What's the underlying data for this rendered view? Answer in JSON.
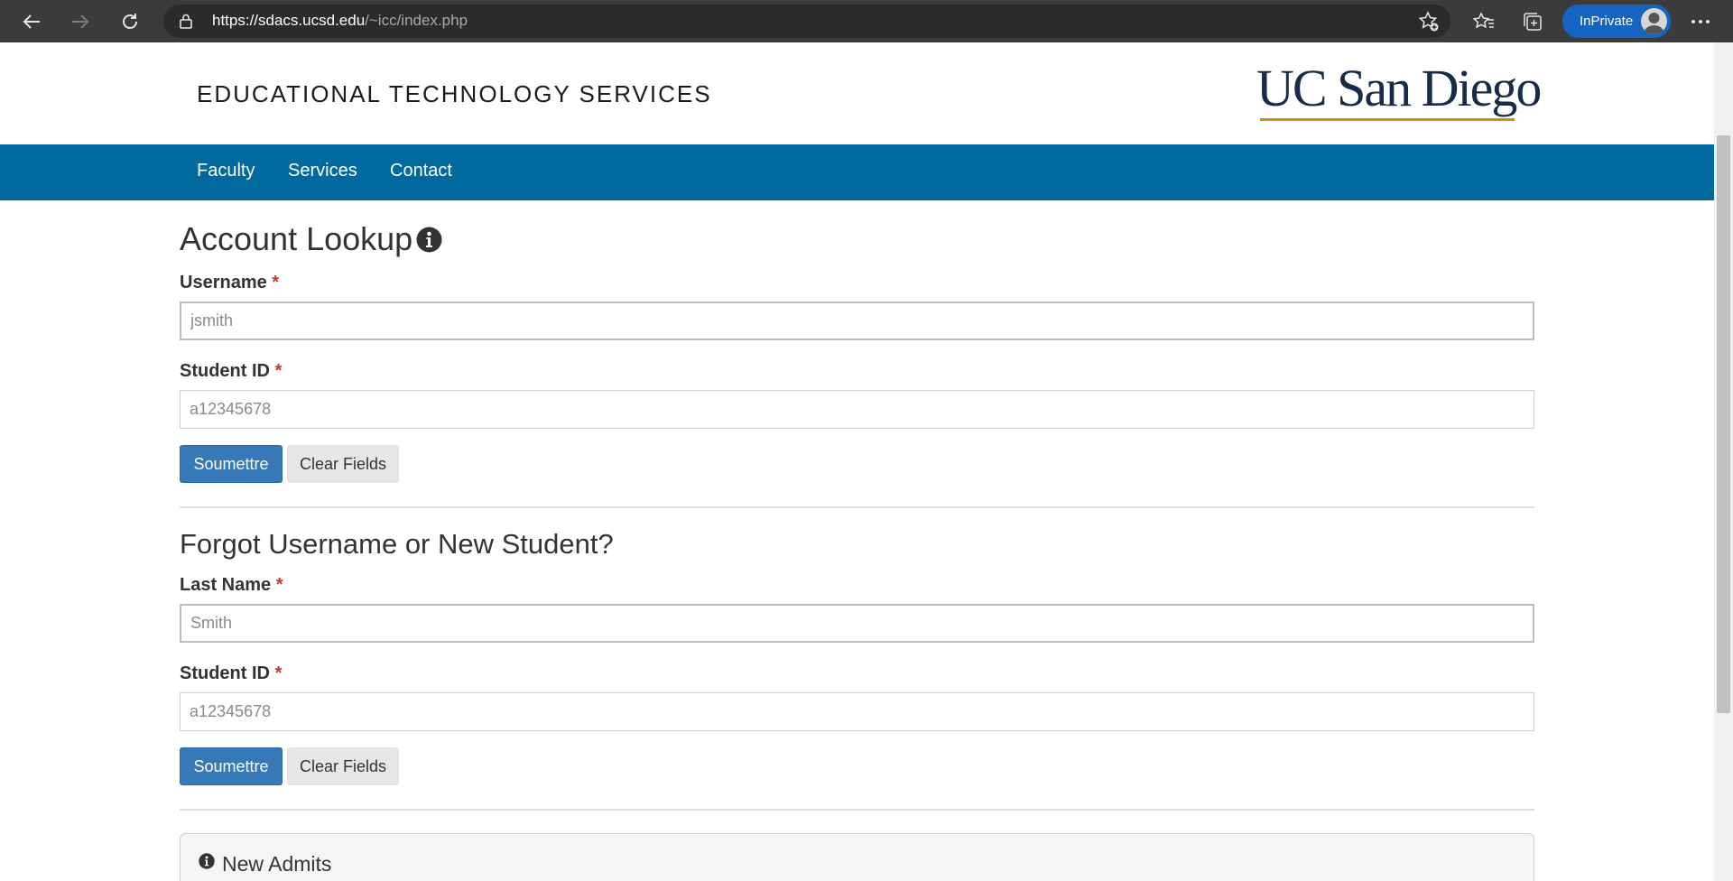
{
  "browser": {
    "url_host": "https://sdacs.ucsd.edu",
    "url_path": "/~icc/index.php",
    "inprivate_label": "InPrivate"
  },
  "header": {
    "site_title": "EDUCATIONAL TECHNOLOGY SERVICES",
    "logo_text": "UC San Diego"
  },
  "nav": {
    "items": [
      {
        "label": "Faculty"
      },
      {
        "label": "Services"
      },
      {
        "label": "Contact"
      }
    ]
  },
  "account_lookup": {
    "title": "Account Lookup",
    "username_label": "Username",
    "username_placeholder": "jsmith",
    "student_id_label": "Student ID",
    "student_id_placeholder": "a12345678",
    "submit_label": "Soumettre",
    "clear_label": "Clear Fields"
  },
  "forgot": {
    "title": "Forgot Username or New Student?",
    "last_name_label": "Last Name",
    "last_name_placeholder": "Smith",
    "student_id_label": "Student ID",
    "student_id_placeholder": "a12345678",
    "submit_label": "Soumettre",
    "clear_label": "Clear Fields"
  },
  "required_marker": "*",
  "new_admits": {
    "title": "New Admits"
  },
  "colors": {
    "nav_bg": "#006a9e",
    "primary_button": "#3579b8",
    "logo_navy": "#182b49",
    "logo_gold": "#c69214",
    "required": "#c0392b"
  }
}
